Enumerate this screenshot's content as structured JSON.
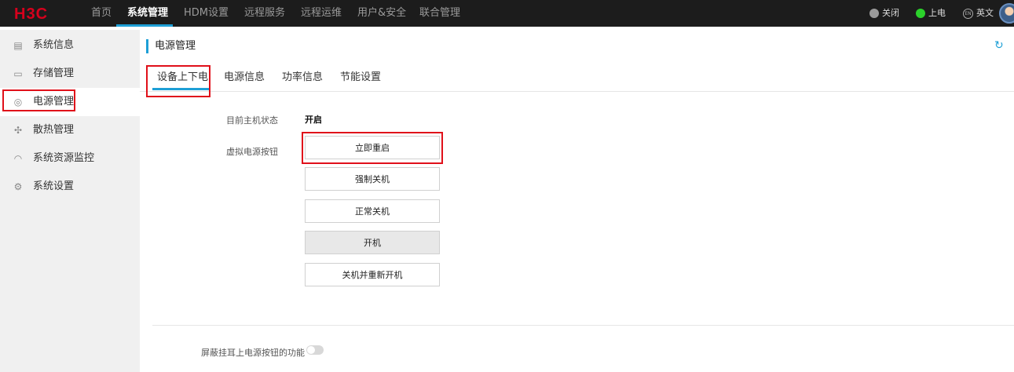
{
  "brand": {
    "logo": "H3C",
    "logo_color": "#d6001c"
  },
  "topnav": {
    "items": [
      {
        "label": "首页"
      },
      {
        "label": "系统管理",
        "active": true
      },
      {
        "label": "HDM设置"
      },
      {
        "label": "远程服务"
      },
      {
        "label": "远程运维"
      },
      {
        "label": "用户&安全"
      },
      {
        "label": "联合管理"
      }
    ],
    "uid_label": "关闭",
    "power_label": "上电",
    "lang_badge": "EN",
    "lang_label": "英文"
  },
  "sidebar": {
    "items": [
      {
        "label": "系统信息",
        "icon": "document-icon"
      },
      {
        "label": "存储管理",
        "icon": "storage-icon"
      },
      {
        "label": "电源管理",
        "icon": "power-icon",
        "active": true
      },
      {
        "label": "散热管理",
        "icon": "fan-icon"
      },
      {
        "label": "系统资源监控",
        "icon": "monitor-icon"
      },
      {
        "label": "系统设置",
        "icon": "settings-icon"
      }
    ]
  },
  "main": {
    "title": "电源管理",
    "tabs": [
      {
        "label": "设备上下电",
        "active": true
      },
      {
        "label": "电源信息"
      },
      {
        "label": "功率信息"
      },
      {
        "label": "节能设置"
      }
    ],
    "host_status_label": "目前主机状态",
    "host_status_value": "开启",
    "virtual_button_label": "虚拟电源按钮",
    "buttons": [
      {
        "label": "立即重启"
      },
      {
        "label": "强制关机"
      },
      {
        "label": "正常关机"
      },
      {
        "label": "开机",
        "disabled": true
      },
      {
        "label": "关机并重新开机"
      }
    ],
    "mask_power_label": "屏蔽挂耳上电源按钮的功能",
    "mask_power_enabled": false
  },
  "colors": {
    "accent": "#1e9fd6",
    "highlight_box": "#e0101a",
    "topbar": "#1c1c1c"
  }
}
